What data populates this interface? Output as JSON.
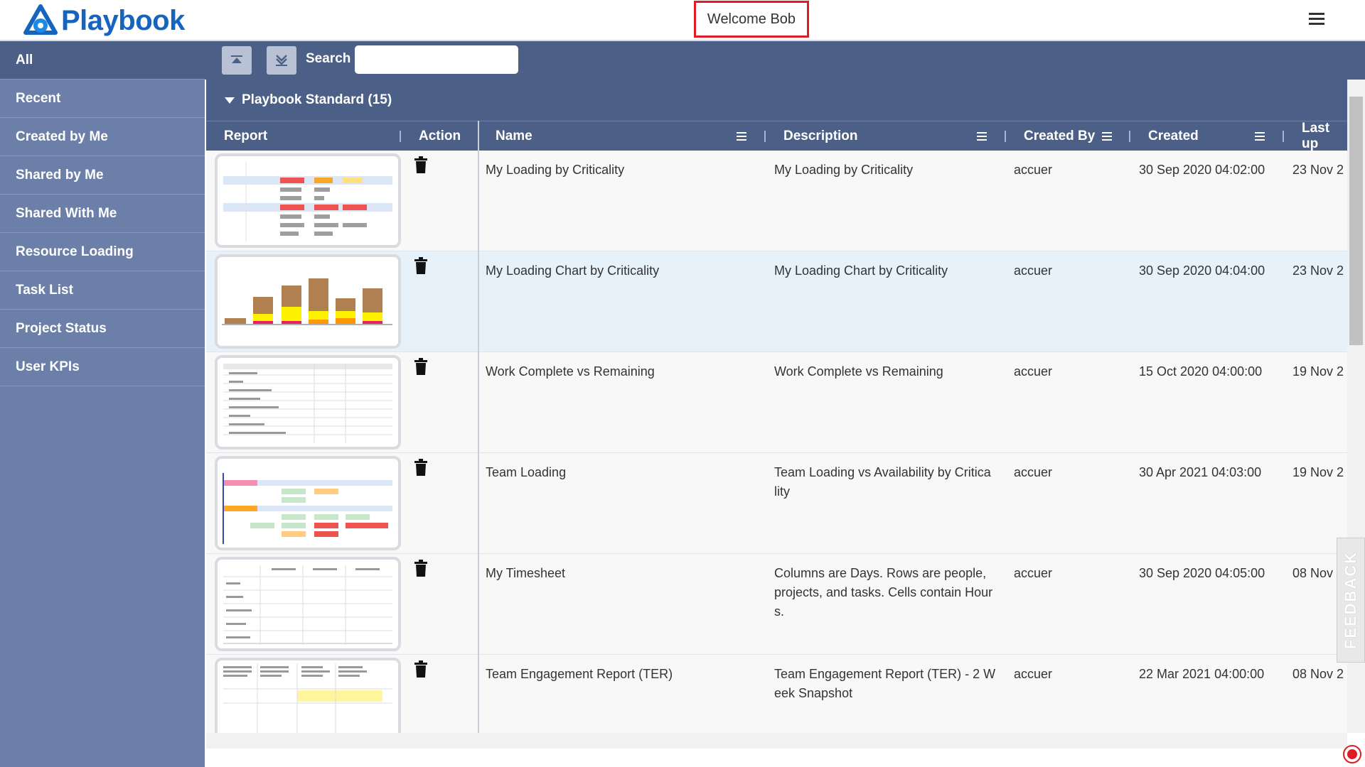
{
  "header": {
    "logo_text": "Playbook",
    "welcome": "Welcome Bob"
  },
  "sidebar": {
    "items": [
      {
        "label": "All",
        "active": true
      },
      {
        "label": "Recent"
      },
      {
        "label": "Created by Me"
      },
      {
        "label": "Shared by Me"
      },
      {
        "label": "Shared With Me"
      },
      {
        "label": "Resource Loading"
      },
      {
        "label": "Task List"
      },
      {
        "label": "Project Status"
      },
      {
        "label": "User KPIs"
      }
    ]
  },
  "toolbar": {
    "search_label": "Search",
    "search_value": ""
  },
  "group": {
    "title": "Playbook Standard (15)"
  },
  "table": {
    "headers": [
      "Report",
      "Action",
      "Name",
      "Description",
      "Created By",
      "Created",
      "Last up"
    ],
    "rows": [
      {
        "name": "My Loading by Criticality",
        "description": "My Loading by Criticality",
        "created_by": "accuer",
        "created": "30 Sep 2020 04:02:00",
        "last": "23 Nov 2"
      },
      {
        "name": "My Loading Chart by Criticality",
        "description": "My Loading Chart by Criticality",
        "created_by": "accuer",
        "created": "30 Sep 2020 04:04:00",
        "last": "23 Nov 2"
      },
      {
        "name": "Work Complete vs Remaining",
        "description": "Work Complete vs Remaining",
        "created_by": "accuer",
        "created": "15 Oct 2020 04:00:00",
        "last": "19 Nov 2"
      },
      {
        "name": "Team Loading",
        "description": "Team Loading vs Availability by Critica lity",
        "created_by": "accuer",
        "created": "30 Apr 2021 04:03:00",
        "last": "19 Nov 2"
      },
      {
        "name": "My Timesheet",
        "description": "Columns are Days. Rows are people, projects, and tasks. Cells contain Hour s.",
        "created_by": "accuer",
        "created": "30 Sep 2020 04:05:00",
        "last": "08 Nov"
      },
      {
        "name": "Team Engagement Report (TER)",
        "description": "Team Engagement Report (TER) - 2 W eek Snapshot",
        "created_by": "accuer",
        "created": "22 Mar 2021 04:00:00",
        "last": "08 Nov 2"
      }
    ]
  },
  "feedback": "FEEDBACK",
  "colors": {
    "brand": "#1565c0",
    "sidebar": "#6b7fa8",
    "header_bar": "#4c5f86",
    "highlight": "#e01b24"
  }
}
